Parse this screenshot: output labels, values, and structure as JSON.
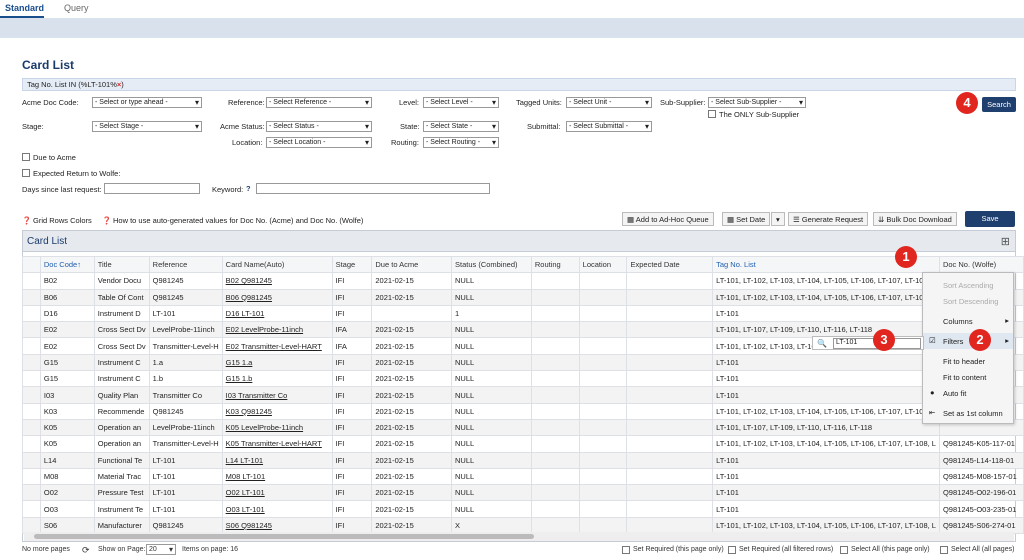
{
  "tabs": [
    "Standard",
    "Query"
  ],
  "page_title": "Card List",
  "filter_chip": {
    "text": "Tag No. List IN (%LT-101%",
    "close": "×",
    "suffix": ")"
  },
  "filters": {
    "acme_doc_code": {
      "label": "Acme Doc Code:",
      "value": "- Select or type ahead -"
    },
    "reference": {
      "label": "Reference:",
      "value": "- Select Reference -"
    },
    "level": {
      "label": "Level:",
      "value": "- Select Level -"
    },
    "tagged_units": {
      "label": "Tagged Units:",
      "value": "- Select Unit -"
    },
    "sub_supplier": {
      "label": "Sub-Supplier:",
      "value": "- Select Sub-Supplier -"
    },
    "only_sub_supplier": "The ONLY Sub-Supplier",
    "stage": {
      "label": "Stage:",
      "value": "- Select Stage -"
    },
    "acme_status": {
      "label": "Acme Status:",
      "value": "- Select Status -"
    },
    "state": {
      "label": "State:",
      "value": "- Select State -"
    },
    "submittal": {
      "label": "Submittal:",
      "value": "- Select Submittal -"
    },
    "location": {
      "label": "Location:",
      "value": "- Select Location -"
    },
    "routing": {
      "label": "Routing:",
      "value": "- Select Routing -"
    },
    "due_to_acme": "Due to Acme",
    "expected_return": "Expected Return to Wolfe:",
    "days_since": "Days since last request:",
    "keyword": "Keyword:"
  },
  "search_label": "Search",
  "help_links": {
    "grid_colors": "Grid Rows Colors",
    "auto_values": "How to use auto-generated values for Doc No. (Acme) and Doc No. (Wolfe)"
  },
  "toolbar": {
    "adhoc": "Add to Ad-Hoc Queue",
    "set_date": "Set Date",
    "generate": "Generate Request",
    "bulk": "Bulk Doc Download",
    "save": "Save"
  },
  "grid_title": "Card List",
  "columns": [
    "Doc Code↑",
    "Title",
    "Reference",
    "Card Name(Auto)",
    "Stage",
    "Due to Acme",
    "Status (Combined)",
    "Routing",
    "Location",
    "Expected Date",
    "Tag No. List",
    "Doc No. (Wolfe)"
  ],
  "rows": [
    [
      "B02",
      "Vendor Docu",
      "Q981245",
      "B02 Q981245",
      "IFI",
      "2021-02-15",
      "NULL",
      "",
      "",
      "",
      "LT-101, LT-102, LT-103, LT-104, LT-105, LT-106, LT-107, LT-108, L",
      ""
    ],
    [
      "B06",
      "Table Of Cont",
      "Q981245",
      "B06 Q981245",
      "IFI",
      "2021-02-15",
      "NULL",
      "",
      "",
      "",
      "LT-101, LT-102, LT-103, LT-104, LT-105, LT-106, LT-107, LT-108, L",
      ""
    ],
    [
      "D16",
      "Instrument D",
      "LT-101",
      "D16 LT-101",
      "IFI",
      "",
      "1",
      "",
      "",
      "",
      "LT-101",
      ""
    ],
    [
      "E02",
      "Cross Sect Dv",
      "LevelProbe-11inch",
      "E02 LevelProbe-11inch",
      "IFA",
      "2021-02-15",
      "NULL",
      "",
      "",
      "",
      "LT-101, LT-107, LT-109, LT-110, LT-116, LT-118",
      ""
    ],
    [
      "E02",
      "Cross Sect Dv",
      "Transmitter-Level-H",
      "E02 Transmitter-Level-HART",
      "IFA",
      "2021-02-15",
      "NULL",
      "",
      "",
      "",
      "LT-101, LT-102, LT-103, LT-104,",
      ""
    ],
    [
      "G15",
      "Instrument C",
      "1.a",
      "G15 1.a",
      "IFI",
      "2021-02-15",
      "NULL",
      "",
      "",
      "",
      "LT-101",
      ""
    ],
    [
      "G15",
      "Instrument C",
      "1.b",
      "G15 1.b",
      "IFI",
      "2021-02-15",
      "NULL",
      "",
      "",
      "",
      "LT-101",
      ""
    ],
    [
      "I03",
      "Quality Plan",
      "Transmitter Co",
      "I03 Transmitter Co",
      "IFI",
      "2021-02-15",
      "NULL",
      "",
      "",
      "",
      "LT-101",
      ""
    ],
    [
      "K03",
      "Recommende",
      "Q981245",
      "K03 Q981245",
      "IFI",
      "2021-02-15",
      "NULL",
      "",
      "",
      "",
      "LT-101, LT-102, LT-103, LT-104, LT-105, LT-106, LT-107, LT-108, L",
      ""
    ],
    [
      "K05",
      "Operation an",
      "LevelProbe-11inch",
      "K05 LevelProbe-11inch",
      "IFI",
      "2021-02-15",
      "NULL",
      "",
      "",
      "",
      "LT-101, LT-107, LT-109, LT-110, LT-116, LT-118",
      ""
    ],
    [
      "K05",
      "Operation an",
      "Transmitter-Level-H",
      "K05 Transmitter-Level-HART",
      "IFI",
      "2021-02-15",
      "NULL",
      "",
      "",
      "",
      "LT-101, LT-102, LT-103, LT-104, LT-105, LT-106, LT-107, LT-108, L",
      "Q981245-K05-117-01"
    ],
    [
      "L14",
      "Functional Te",
      "LT-101",
      "L14 LT-101",
      "IFI",
      "2021-02-15",
      "NULL",
      "",
      "",
      "",
      "LT-101",
      "Q981245-L14-118-01"
    ],
    [
      "M08",
      "Material Trac",
      "LT-101",
      "M08 LT-101",
      "IFI",
      "2021-02-15",
      "NULL",
      "",
      "",
      "",
      "LT-101",
      "Q981245-M08-157-01"
    ],
    [
      "O02",
      "Pressure Test",
      "LT-101",
      "O02 LT-101",
      "IFI",
      "2021-02-15",
      "NULL",
      "",
      "",
      "",
      "LT-101",
      "Q981245-O02-196-01"
    ],
    [
      "O03",
      "Instrument Te",
      "LT-101",
      "O03 LT-101",
      "IFI",
      "2021-02-15",
      "NULL",
      "",
      "",
      "",
      "LT-101",
      "Q981245-O03-235-01"
    ],
    [
      "S06",
      "Manufacturer",
      "Q981245",
      "S06 Q981245",
      "IFI",
      "2021-02-15",
      "X",
      "",
      "",
      "",
      "LT-101, LT-102, LT-103, LT-104, LT-105, LT-106, LT-107, LT-108, L",
      "Q981245-S06-274-01"
    ]
  ],
  "menu": {
    "sort_asc": "Sort Ascending",
    "sort_desc": "Sort Descending",
    "columns": "Columns",
    "filters": "Filters",
    "fit_header": "Fit to header",
    "fit_content": "Fit to content",
    "auto_fit": "Auto fit",
    "set_first": "Set as 1st column"
  },
  "filter_value": "LT-101",
  "badges": [
    "1",
    "2",
    "3",
    "4"
  ],
  "footer": {
    "no_more": "No more pages",
    "show_on_page": "Show on Page:",
    "page_size": "20",
    "items": "Items on page: 16",
    "set_req_page": "Set Required (this page only)",
    "set_req_all": "Set Required (all filtered rows)",
    "sel_page": "Select All (this page only)",
    "sel_all": "Select All (all pages)"
  },
  "colors": {
    "accent": "#1f3f6e",
    "badge": "#e0261f",
    "link": "#1f5fb0"
  }
}
